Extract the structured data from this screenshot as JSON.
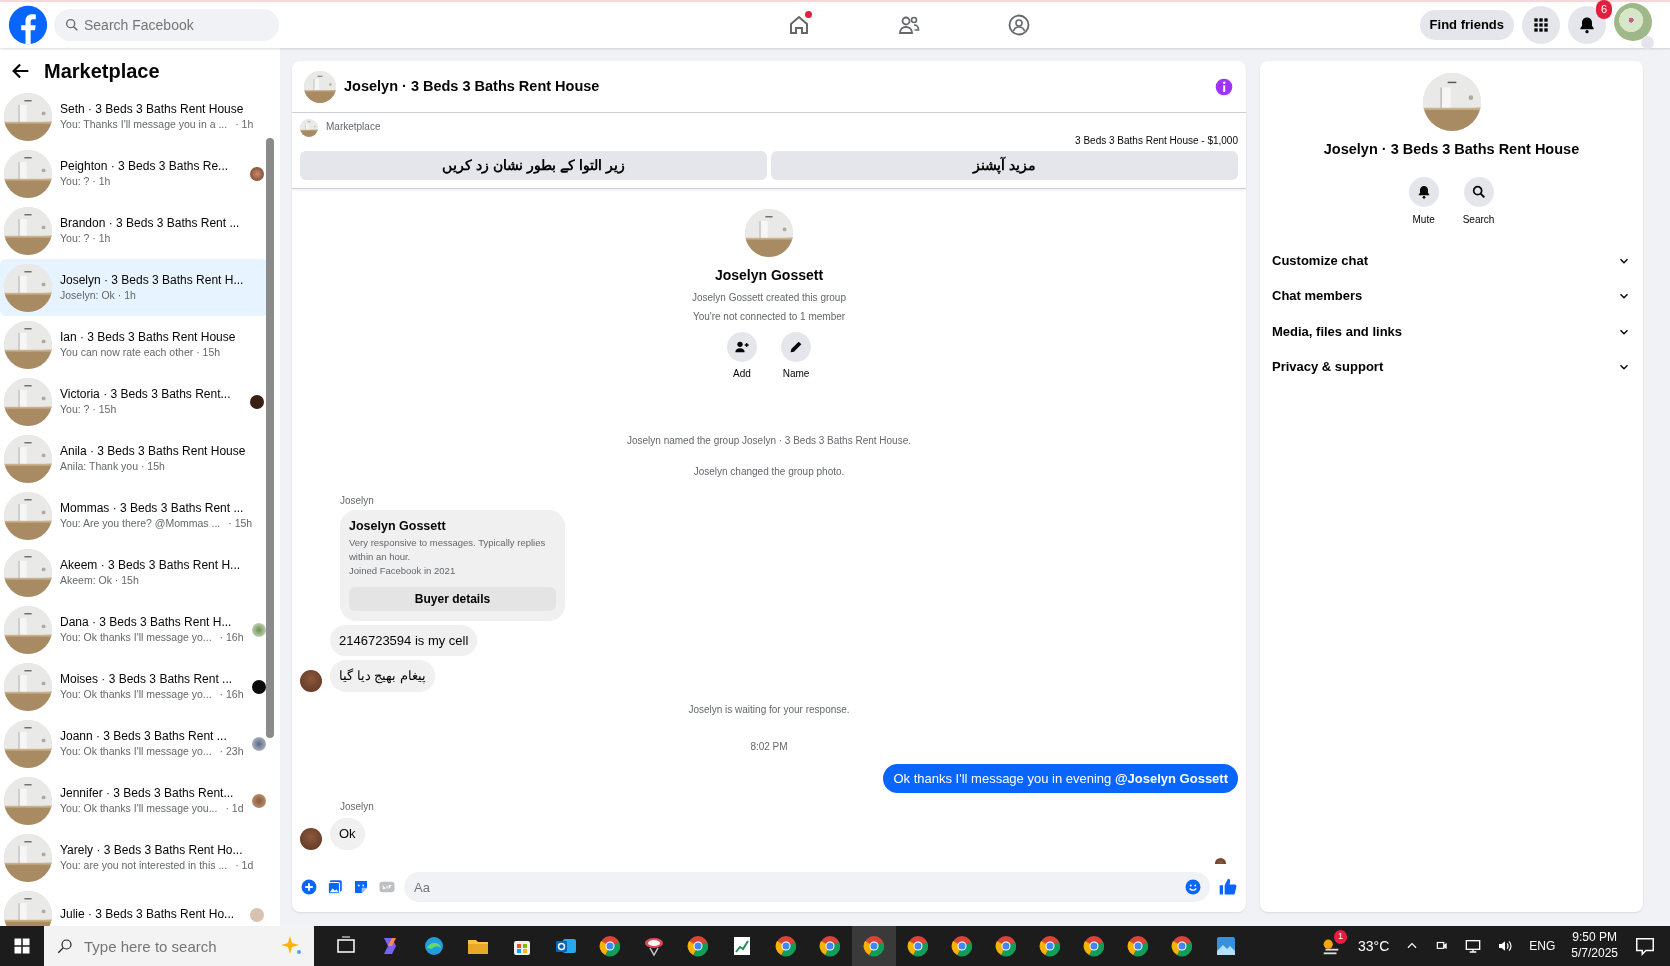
{
  "topbar": {
    "search_placeholder": "Search Facebook",
    "nav": [
      {
        "kind": "home",
        "selected": false,
        "dot": true
      },
      {
        "kind": "friends",
        "selected": false,
        "dot": false
      },
      {
        "kind": "groups",
        "selected": false,
        "dot": false
      }
    ],
    "find_friends": "Find friends",
    "notifications_badge": "6"
  },
  "sidebar": {
    "title": "Marketplace",
    "conversations": [
      {
        "title": "Seth · 3 Beds 3 Baths Rent House",
        "preview": "You: Thanks I'll message you in a ...",
        "time": "· 1h",
        "selected": false,
        "seen": false
      },
      {
        "title": "Peighton · 3 Beds 3 Baths Re...",
        "preview": "You: ? · 1h",
        "selected": false,
        "seen": true
      },
      {
        "title": "Brandon · 3 Beds 3 Baths Rent ...",
        "preview": "You: ? · 1h",
        "selected": false,
        "seen": false
      },
      {
        "title": "Joselyn · 3 Beds 3 Baths Rent H...",
        "preview": "Joselyn: Ok · 1h",
        "selected": true,
        "seen": false
      },
      {
        "title": "Ian · 3 Beds 3 Baths Rent House",
        "preview": "You can now rate each other · 15h",
        "selected": false,
        "seen": false
      },
      {
        "title": "Victoria · 3 Beds 3 Baths Rent...",
        "preview": "You: ? · 15h",
        "selected": false,
        "seen": true
      },
      {
        "title": "Anila · 3 Beds 3 Baths Rent House",
        "preview": "Anila: Thank you · 15h",
        "selected": false,
        "seen": false
      },
      {
        "title": "Mommas · 3 Beds 3 Baths Rent ...",
        "preview": "You: Are you there? @Mommas ...",
        "time": "· 15h",
        "selected": false,
        "seen": false
      },
      {
        "title": "Akeem · 3 Beds 3 Baths Rent H...",
        "preview": "Akeem: Ok · 15h",
        "selected": false,
        "seen": false
      },
      {
        "title": "Dana · 3 Beds 3 Baths Rent H...",
        "preview": "You: Ok thanks I'll message yo...",
        "time": "· 16h",
        "selected": false,
        "seen": true
      },
      {
        "title": "Moises · 3 Beds 3 Baths Rent ...",
        "preview": "You: Ok thanks I'll message yo...",
        "time": "· 16h",
        "selected": false,
        "seen": true
      },
      {
        "title": "Joann · 3 Beds 3 Baths Rent ...",
        "preview": "You: Ok thanks I'll message yo...",
        "time": "· 23h",
        "selected": false,
        "seen": true
      },
      {
        "title": "Jennifer · 3 Beds 3 Baths Rent...",
        "preview": "You: Ok thanks I'll message you...",
        "time": "· 1d",
        "selected": false,
        "seen": true
      },
      {
        "title": "Yarely · 3 Beds 3 Baths Rent Ho...",
        "preview": "You: are you not interested in this ...",
        "time": "· 1d",
        "selected": false,
        "seen": false
      },
      {
        "title": "Julie · 3 Beds 3 Baths Rent Ho...",
        "selected": false,
        "seen": true
      }
    ]
  },
  "chat": {
    "title": "Joselyn · 3 Beds 3 Baths Rent House",
    "source": "Marketplace",
    "listing": "3 Beds 3 Baths Rent House - $1,000",
    "actions": [
      "مزید آپشنز",
      "زیر التوا کے بطور نشان زد کریں"
    ],
    "intro": {
      "name": "Joselyn Gossett",
      "lines": [
        "Joselyn Gossett created this group",
        "You're not connected to 1 member"
      ],
      "buttons": [
        {
          "kind": "add",
          "label": "Add"
        },
        {
          "kind": "name",
          "label": "Name"
        }
      ]
    },
    "messages": [
      {
        "kind": "system",
        "text": "Joselyn named the group Joselyn · 3 Beds 3 Baths Rent House."
      },
      {
        "kind": "system",
        "text": "Joselyn changed the group photo."
      },
      {
        "kind": "sender",
        "text": "Joselyn"
      },
      {
        "kind": "card",
        "name": "Joselyn Gossett",
        "lines": [
          "Very responsive to messages. Typically replies within an hour.",
          "Joined Facebook in 2021"
        ],
        "button": "Buyer details"
      },
      {
        "kind": "incoming",
        "text": "2146723594 is my cell",
        "avatar": false
      },
      {
        "kind": "incoming",
        "text": "پیغام بھیج دیا گیا",
        "avatar": true
      },
      {
        "kind": "system",
        "text": "Joselyn is waiting for your response."
      },
      {
        "kind": "time",
        "text": "8:02 PM"
      },
      {
        "kind": "outgoing",
        "text": "Ok thanks I'll message you in evening **@Joselyn Gossett**"
      },
      {
        "kind": "sender",
        "text": "Joselyn"
      },
      {
        "kind": "incoming",
        "text": "Ok",
        "avatar": true
      },
      {
        "kind": "seen"
      }
    ],
    "composer_placeholder": "Aa"
  },
  "info": {
    "title": "Joselyn · 3 Beds 3 Baths Rent House",
    "actions": [
      {
        "kind": "mute",
        "label": "Mute"
      },
      {
        "kind": "search",
        "label": "Search"
      }
    ],
    "sections": [
      {
        "label": "Customize chat",
        "expanded": false
      },
      {
        "label": "Chat members",
        "expanded": false
      },
      {
        "label": "Media, files and links",
        "expanded": false
      },
      {
        "label": "Privacy & support",
        "expanded": false
      }
    ]
  },
  "taskbar": {
    "search_placeholder": "Type here to search",
    "temperature": "33°C",
    "weather_badge": "1",
    "language": "ENG",
    "time": "9:50 PM",
    "date": "5/7/2025"
  }
}
